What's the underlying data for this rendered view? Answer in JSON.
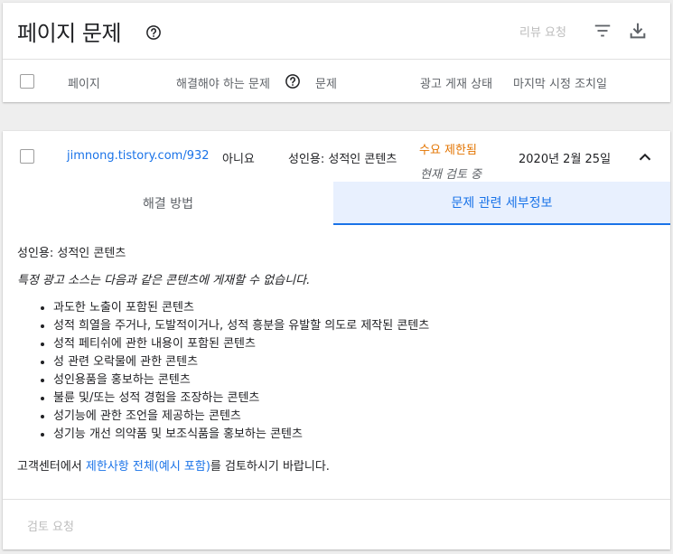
{
  "header": {
    "title": "페이지 문제",
    "review_request": "리뷰 요청"
  },
  "columns": {
    "page": "페이지",
    "must_fix": "해결해야 하는 문제",
    "issue": "문제",
    "ad_status": "광고 게재 상태",
    "last_action": "마지막 시정 조치일"
  },
  "row": {
    "page_url": "jimnong.tistory.com/932",
    "must_fix": "아니요",
    "issue": "성인용: 성적인 콘텐츠",
    "status": "수요 제한됨",
    "status_sub": "현재 검토 중",
    "date": "2020년 2월 25일"
  },
  "tabs": {
    "solution": "해결 방법",
    "details": "문제 관련 세부정보"
  },
  "details": {
    "title": "성인용: 성적인 콘텐츠",
    "intro": "특정 광고 소스는 다음과 같은 콘텐츠에 게재할 수 없습니다.",
    "items": [
      "과도한 노출이 포함된 콘텐츠",
      "성적 희열을 주거나, 도발적이거나, 성적 흥분을 유발할 의도로 제작된 콘텐츠",
      "성적 페티쉬에 관한 내용이 포함된 콘텐츠",
      "성 관련 오락물에 관한 콘텐츠",
      "성인용품을 홍보하는 콘텐츠",
      "불륜 및/또는 성적 경험을 조장하는 콘텐츠",
      "성기능에 관한 조언을 제공하는 콘텐츠",
      "성기능 개선 의약품 및 보조식품을 홍보하는 콘텐츠"
    ],
    "footer_prefix": "고객센터에서 ",
    "footer_link": "제한사항 전체(예시 포함)",
    "footer_suffix": "를 검토하시기 바랍니다."
  },
  "bottom": {
    "review_request": "검토 요청"
  },
  "colors": {
    "accent": "#1a73e8",
    "status_warning": "#e37400",
    "disabled": "#bdbdbd"
  }
}
